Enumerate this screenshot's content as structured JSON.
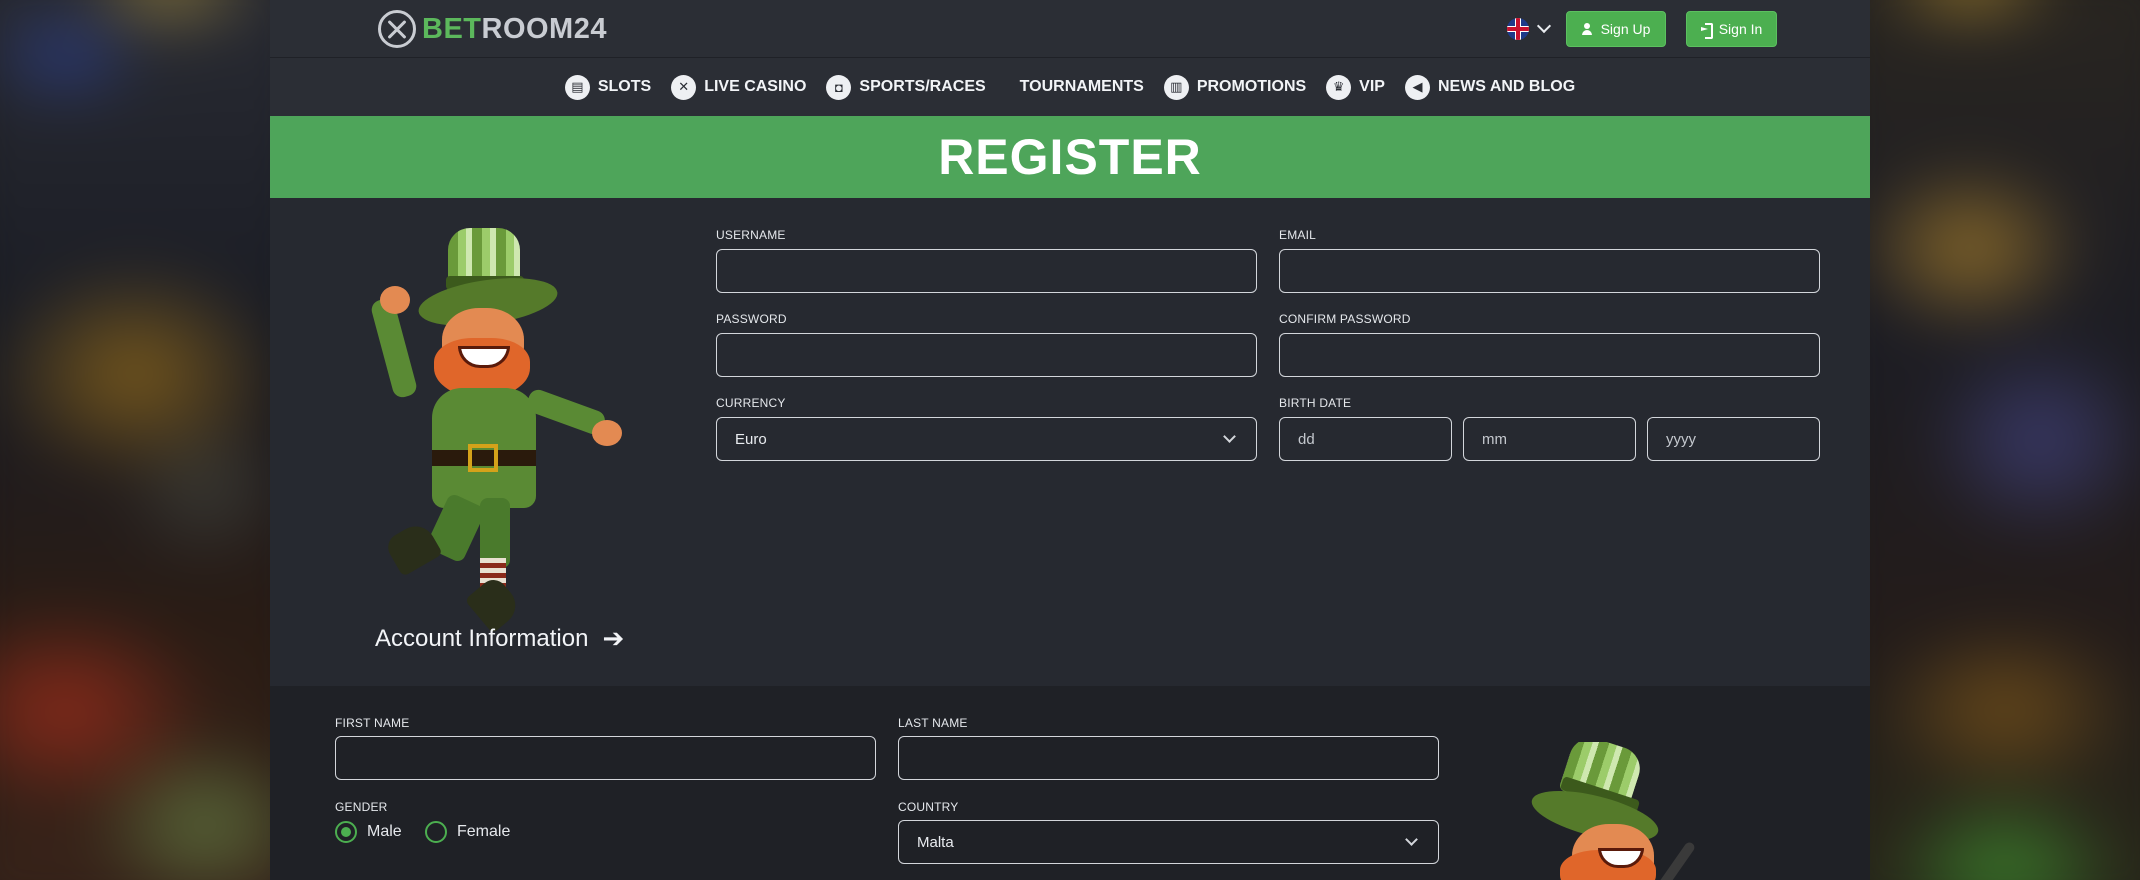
{
  "header": {
    "logo_prefix": "BET",
    "logo_suffix": "ROOM24",
    "language_icon": "uk-flag-icon",
    "signup_label": "Sign Up",
    "signin_label": "Sign In"
  },
  "nav": {
    "items": [
      {
        "label": "SLOTS",
        "icon": "slots-icon"
      },
      {
        "label": "LIVE CASINO",
        "icon": "roulette-icon"
      },
      {
        "label": "SPORTS/RACES",
        "icon": "vr-headset-icon"
      },
      {
        "label": "TOURNAMENTS",
        "icon": ""
      },
      {
        "label": "PROMOTIONS",
        "icon": "gift-icon"
      },
      {
        "label": "VIP",
        "icon": "crown-icon"
      },
      {
        "label": "NEWS AND BLOG",
        "icon": "megaphone-icon"
      }
    ]
  },
  "banner": {
    "title": "REGISTER"
  },
  "account": {
    "username_label": "USERNAME",
    "email_label": "EMAIL",
    "password_label": "PASSWORD",
    "confirm_password_label": "CONFIRM PASSWORD",
    "currency_label": "CURRENCY",
    "currency_value": "Euro",
    "birth_date_label": "BIRTH DATE",
    "day_placeholder": "dd",
    "month_placeholder": "mm",
    "year_placeholder": "yyyy",
    "section_link": "Account Information"
  },
  "personal": {
    "first_name_label": "FIRST NAME",
    "last_name_label": "LAST NAME",
    "gender_label": "GENDER",
    "gender_options": [
      "Male",
      "Female"
    ],
    "gender_selected": "Male",
    "country_label": "COUNTRY",
    "country_value": "Malta"
  },
  "colors": {
    "accent": "#4caf50",
    "banner": "#4ea55a",
    "page_bg": "#262930",
    "header_bg": "#2b2e35"
  }
}
